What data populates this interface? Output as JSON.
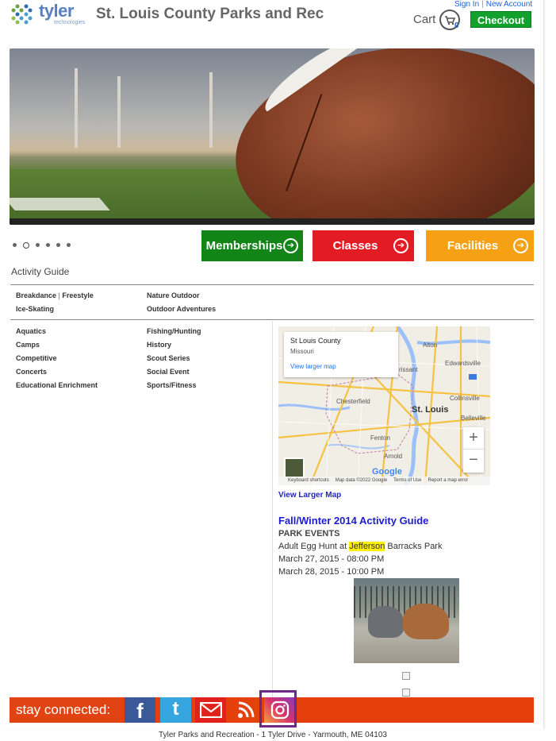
{
  "header": {
    "logo_text": "tyler",
    "logo_sub": "technologies",
    "site_title": "St. Louis County Parks and Rec",
    "sign_in": "Sign In",
    "separator": "|",
    "new_account": "New Account",
    "cart_label": "Cart",
    "cart_count": "0",
    "checkout_label": "Checkout"
  },
  "carousel": {
    "slide_count": 6,
    "active_index": 1
  },
  "cta": {
    "memberships": "Memberships",
    "classes": "Classes",
    "facilities": "Facilities",
    "colors": {
      "memberships": "#138418",
      "classes": "#e31b23",
      "facilities": "#f5a113"
    }
  },
  "activity_guide": {
    "title": "Activity Guide",
    "featured_left": [
      "Breakdance",
      "Ice-Skating"
    ],
    "featured_left_extra": "Freestyle",
    "featured_right": [
      "Nature Outdoor",
      "Outdoor Adventures"
    ],
    "left": [
      "Aquatics",
      "Camps",
      "Competitive",
      "Concerts",
      "Educational Enrichment"
    ],
    "right": [
      "Fishing/Hunting",
      "History",
      "Scout Series",
      "Social Event",
      "Sports/Fitness"
    ]
  },
  "map": {
    "card_title": "St Louis County",
    "card_subtitle": "Missouri",
    "card_link": "View larger map",
    "cities": {
      "alton": "Alton",
      "edwardsville": "Edwardsville",
      "florissant": "rissant",
      "collinsville": "Collinsville",
      "chesterfield": "Chesterfield",
      "stlouis": "St. Louis",
      "fenton": "Fenton",
      "arnold": "Arnold",
      "belleville": "Belleville"
    },
    "zoom_in": "+",
    "zoom_out": "−",
    "google": "Google",
    "footer": [
      "Keyboard shortcuts",
      "Map data ©2022 Google",
      "Terms of Use",
      "Report a map error"
    ],
    "view_larger": "View Larger Map"
  },
  "events": {
    "guide_link": "Fall/Winter 2014 Activity Guide",
    "section": "PARK EVENTS",
    "event_prefix": "Adult Egg Hunt at ",
    "event_highlight": "Jefferson",
    "event_suffix": " Barracks Park",
    "dates": [
      "March 27, 2015 - 08:00 PM",
      "March 28, 2015 - 10:00 PM"
    ]
  },
  "social": {
    "stay_connected": "stay connected:",
    "facebook": "f",
    "twitter": "t",
    "colors": {
      "bar": "#e53f0e",
      "facebook": "#3b5998",
      "twitter": "#35a6e0",
      "email": "#e0211c",
      "rss": "#e5410c",
      "instagram": "#b1408d"
    }
  },
  "footer": {
    "address": "Tyler Parks and Recreation - 1 Tyler Drive - Yarmouth, ME 04103"
  }
}
